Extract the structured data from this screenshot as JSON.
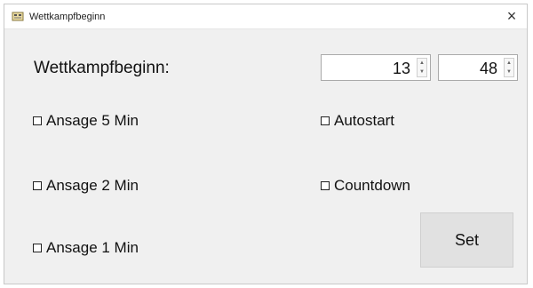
{
  "window": {
    "title": "Wettkampfbeginn",
    "close_glyph": "×",
    "icon": "app-icon"
  },
  "form": {
    "label": "Wettkampfbeginn:",
    "hour_value": "13",
    "minute_value": "48",
    "spinner_up": "▲",
    "spinner_down": "▼"
  },
  "checkboxes": {
    "ansage5": {
      "label": "Ansage 5 Min",
      "checked": false
    },
    "ansage2": {
      "label": "Ansage 2 Min",
      "checked": false
    },
    "ansage1": {
      "label": "Ansage 1 Min",
      "checked": false
    },
    "autostart": {
      "label": "Autostart",
      "checked": false
    },
    "countdown": {
      "label": "Countdown",
      "checked": false
    }
  },
  "buttons": {
    "set_label": "Set"
  }
}
